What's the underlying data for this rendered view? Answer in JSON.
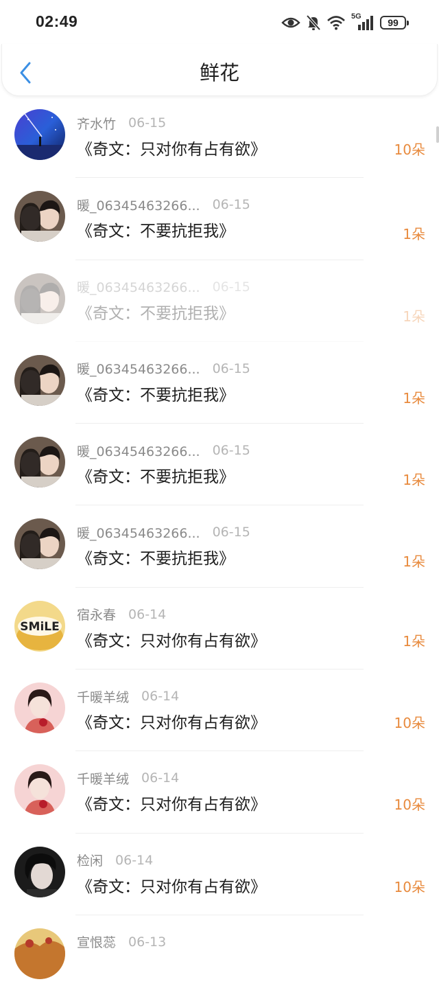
{
  "status": {
    "time": "02:49",
    "network": "5G",
    "battery": "99"
  },
  "header": {
    "title": "鲜花"
  },
  "items": [
    {
      "name": "齐水竹",
      "date": "06-15",
      "title": "《奇文：只对你有占有欲》",
      "count": "10朵",
      "avatar": "night-sky-avatar"
    },
    {
      "name": "暖_06345463266...",
      "date": "06-15",
      "title": "《奇文：不要抗拒我》",
      "count": "1朵",
      "avatar": "couple-avatar"
    },
    {
      "name": "暖_06345463266...",
      "date": "06-15",
      "title": "《奇文：不要抗拒我》",
      "count": "1朵",
      "avatar": "couple-avatar"
    },
    {
      "name": "暖_06345463266...",
      "date": "06-15",
      "title": "《奇文：不要抗拒我》",
      "count": "1朵",
      "avatar": "couple-avatar"
    },
    {
      "name": "暖_06345463266...",
      "date": "06-15",
      "title": "《奇文：不要抗拒我》",
      "count": "1朵",
      "avatar": "couple-avatar"
    },
    {
      "name": "暖_06345463266...",
      "date": "06-15",
      "title": "《奇文：不要抗拒我》",
      "count": "1朵",
      "avatar": "couple-avatar"
    },
    {
      "name": "宿永春",
      "date": "06-14",
      "title": "《奇文：只对你有占有欲》",
      "count": "1朵",
      "avatar": "smile-avatar"
    },
    {
      "name": "千暖羊绒",
      "date": "06-14",
      "title": "《奇文：只对你有占有欲》",
      "count": "10朵",
      "avatar": "girl-rose-avatar"
    },
    {
      "name": "千暖羊绒",
      "date": "06-14",
      "title": "《奇文：只对你有占有欲》",
      "count": "10朵",
      "avatar": "girl-rose-avatar"
    },
    {
      "name": "检闲",
      "date": "06-14",
      "title": "《奇文：只对你有占有欲》",
      "count": "10朵",
      "avatar": "boy-avatar"
    },
    {
      "name": "宣恨蕊",
      "date": "06-13",
      "title": "",
      "count": "",
      "avatar": "landscape-avatar"
    }
  ]
}
